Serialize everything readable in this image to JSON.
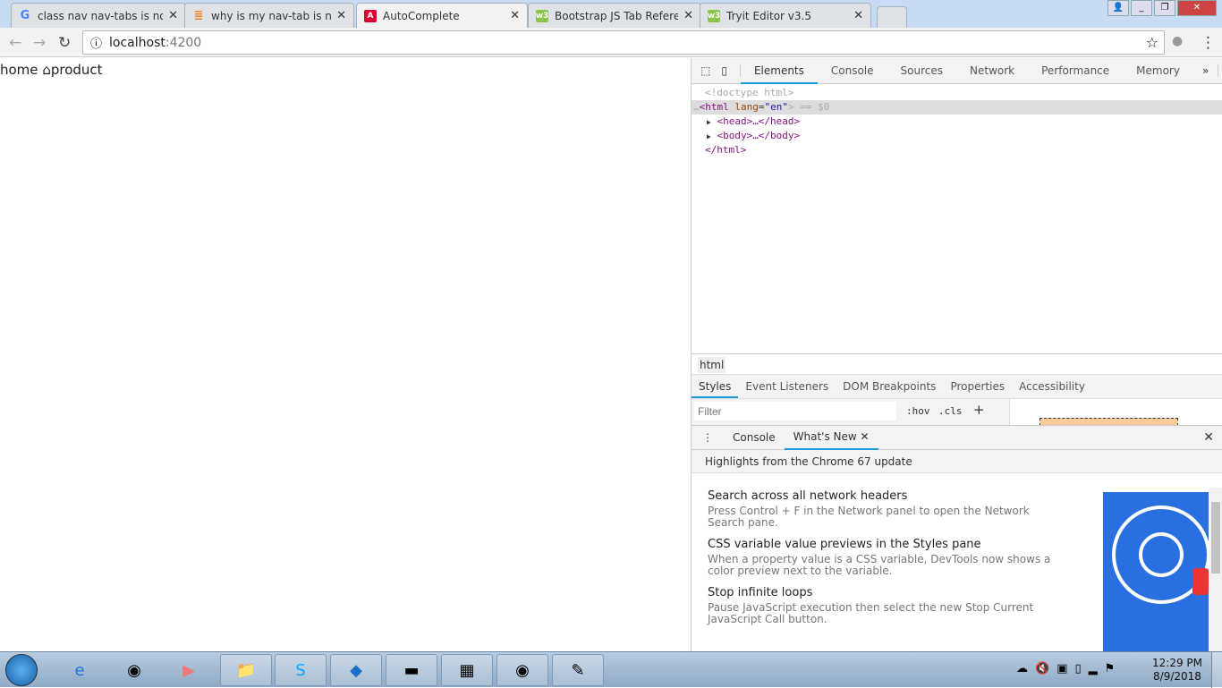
{
  "browser": {
    "tabs": [
      {
        "title": "class nav nav-tabs is not",
        "icon": "google-icon",
        "color": "#4285f4",
        "active": false
      },
      {
        "title": "why is my nav-tab is not",
        "icon": "stackoverflow-icon",
        "color": "#f48024",
        "active": false
      },
      {
        "title": "AutoComplete",
        "icon": "angular-icon",
        "color": "#dd0031",
        "active": true
      },
      {
        "title": "Bootstrap JS Tab Referen",
        "icon": "w3schools-icon",
        "color": "#8ac44c",
        "active": false
      },
      {
        "title": "Tryit Editor v3.5",
        "icon": "w3schools-icon",
        "color": "#8ac44c",
        "active": false
      }
    ],
    "url_host": "localhost",
    "url_port": ":4200"
  },
  "page": {
    "home_link": "home",
    "product_link": "product"
  },
  "devtools": {
    "tabs": [
      "Elements",
      "Console",
      "Sources",
      "Network",
      "Performance",
      "Memory"
    ],
    "dom": {
      "doctype": "<!doctype html>",
      "html_open": "<html",
      "lang_attr": "lang",
      "lang_val": "\"en\"",
      "selected_suffix": "> == $0",
      "head": "<head>…</head>",
      "body": "<body>…</body>",
      "html_close": "</html>"
    },
    "breadcrumb": "html",
    "subtabs": [
      "Styles",
      "Event Listeners",
      "DOM Breakpoints",
      "Properties",
      "Accessibility"
    ],
    "filter_placeholder": "Filter",
    "hov": ":hov",
    "cls": ".cls",
    "plus": "+",
    "drawer_tabs": [
      "Console",
      "What's New"
    ],
    "highlights": "Highlights from the Chrome 67 update",
    "news": [
      {
        "title": "Search across all network headers",
        "desc": "Press Control + F in the Network panel to open the Network Search pane."
      },
      {
        "title": "CSS variable value previews in the Styles pane",
        "desc": "When a property value is a CSS variable, DevTools now shows a color preview next to the variable."
      },
      {
        "title": "Stop infinite loops",
        "desc": "Pause JavaScript execution then select the new Stop Current JavaScript Call button."
      }
    ]
  },
  "taskbar": {
    "time": "12:29 PM",
    "date": "8/9/2018"
  }
}
